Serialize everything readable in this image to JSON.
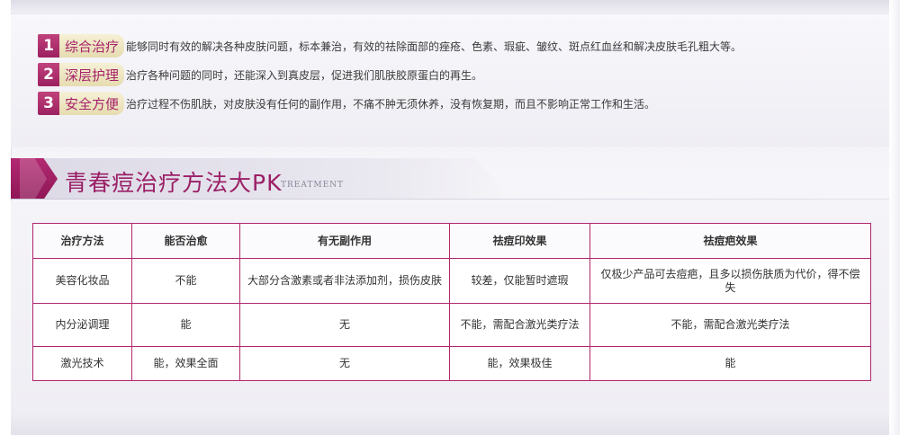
{
  "features": [
    {
      "num": "1",
      "title": "综合治疗",
      "desc": "能够同时有效的解决各种皮肤问题，标本兼治，有效的祛除面部的痤疮、色素、瑕疵、皱纹、斑点红血丝和解决皮肤毛孔粗大等。"
    },
    {
      "num": "2",
      "title": "深层护理",
      "desc": "治疗各种问题的同时，还能深入到真皮层，促进我们肌肤胶原蛋白的再生。"
    },
    {
      "num": "3",
      "title": "安全方便",
      "desc": "治疗过程不伤肌肤，对皮肤没有任何的副作用，不痛不肿无须休养，没有恢复期，而且不影响正常工作和生活。"
    }
  ],
  "section": {
    "title": "青春痘治疗方法大PK",
    "subtitle": "TREATMENT"
  },
  "table": {
    "headers": [
      "治疗方法",
      "能否治愈",
      "有无副作用",
      "祛痘印效果",
      "祛痘疤效果"
    ],
    "rows": [
      [
        "美容化妆品",
        "不能",
        "大部分含激素或者非法添加剂，损伤皮肤",
        "较差，仅能暂时遮瑕",
        "仅极少产品可去痘疤，且多以损伤肤质为代价，得不偿失"
      ],
      [
        "内分泌调理",
        "能",
        "无",
        "不能，需配合激光类疗法",
        "不能，需配合激光类疗法"
      ],
      [
        "激光技术",
        "能，效果全面",
        "无",
        "能，效果极佳",
        "能"
      ]
    ]
  },
  "colors": {
    "accent": "#9b1f66",
    "border": "#b0276d",
    "badge": "#b32a73"
  }
}
